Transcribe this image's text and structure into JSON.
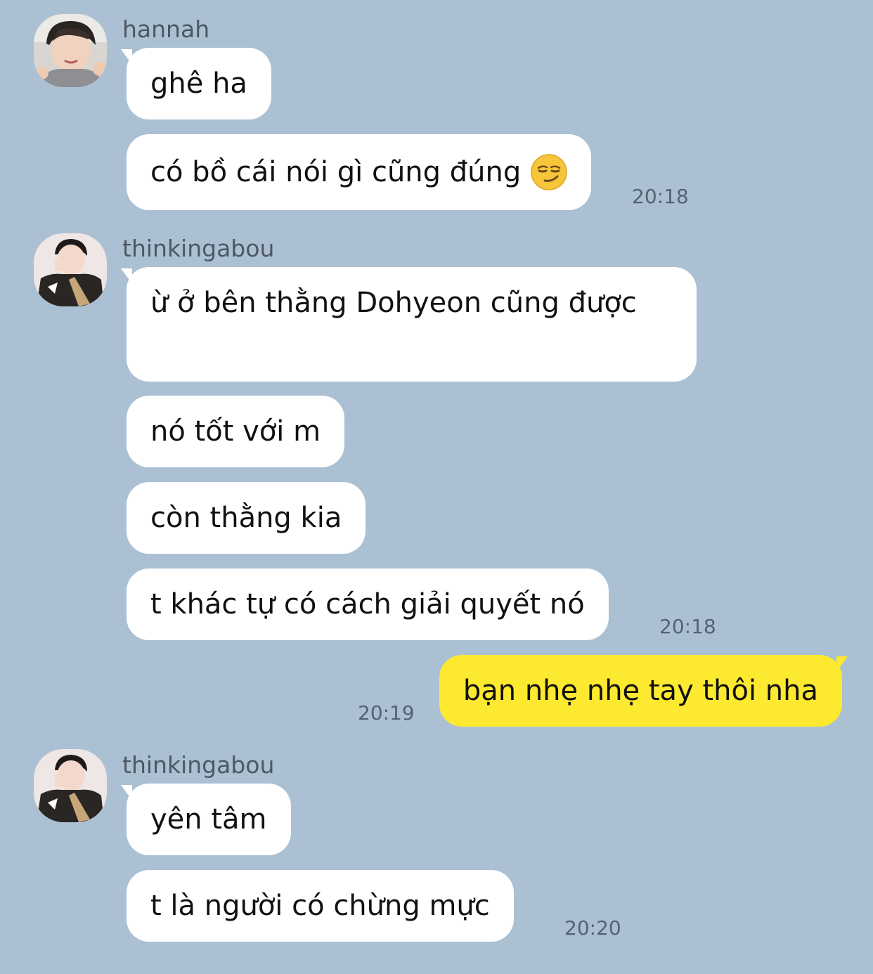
{
  "messages": [
    {
      "sender": "hannah",
      "bubbles": [
        "ghê ha",
        "có bồ cái nói gì cũng đúng"
      ],
      "emoji": "smirking-face-emoji",
      "time": "20:18"
    },
    {
      "sender": "thinkingabou",
      "bubbles": [
        "ừ ở bên thằng Dohyeon cũng được",
        "nó tốt với m",
        "còn thằng kia",
        "t khác tự có cách giải quyết nó"
      ],
      "time": "20:18"
    },
    {
      "sender": "me",
      "bubbles": [
        "bạn nhẹ nhẹ tay thôi nha"
      ],
      "time": "20:19"
    },
    {
      "sender": "thinkingabou",
      "bubbles": [
        "yên tâm",
        "t là người có chừng mực"
      ],
      "time": "20:20"
    }
  ],
  "colors": {
    "background": "#abc1d3",
    "incoming_bubble": "#ffffff",
    "outgoing_bubble": "#fde92f"
  }
}
